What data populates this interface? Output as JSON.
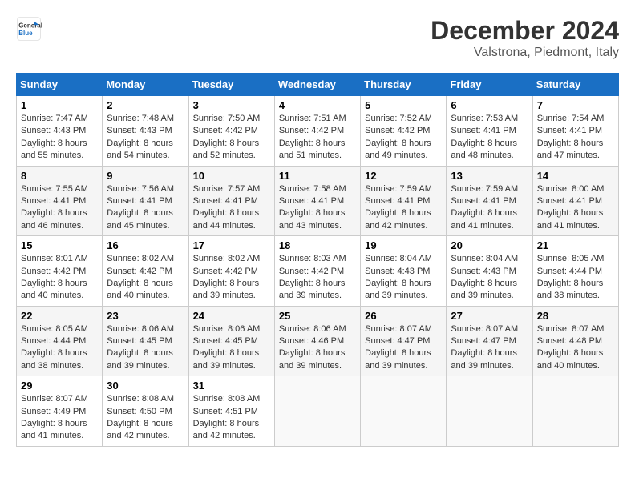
{
  "logo": {
    "line1": "General",
    "line2": "Blue"
  },
  "title": "December 2024",
  "subtitle": "Valstrona, Piedmont, Italy",
  "weekdays": [
    "Sunday",
    "Monday",
    "Tuesday",
    "Wednesday",
    "Thursday",
    "Friday",
    "Saturday"
  ],
  "weeks": [
    [
      {
        "day": "1",
        "sunrise": "7:47 AM",
        "sunset": "4:43 PM",
        "daylight": "8 hours and 55 minutes."
      },
      {
        "day": "2",
        "sunrise": "7:48 AM",
        "sunset": "4:43 PM",
        "daylight": "8 hours and 54 minutes."
      },
      {
        "day": "3",
        "sunrise": "7:50 AM",
        "sunset": "4:42 PM",
        "daylight": "8 hours and 52 minutes."
      },
      {
        "day": "4",
        "sunrise": "7:51 AM",
        "sunset": "4:42 PM",
        "daylight": "8 hours and 51 minutes."
      },
      {
        "day": "5",
        "sunrise": "7:52 AM",
        "sunset": "4:42 PM",
        "daylight": "8 hours and 49 minutes."
      },
      {
        "day": "6",
        "sunrise": "7:53 AM",
        "sunset": "4:41 PM",
        "daylight": "8 hours and 48 minutes."
      },
      {
        "day": "7",
        "sunrise": "7:54 AM",
        "sunset": "4:41 PM",
        "daylight": "8 hours and 47 minutes."
      }
    ],
    [
      {
        "day": "8",
        "sunrise": "7:55 AM",
        "sunset": "4:41 PM",
        "daylight": "8 hours and 46 minutes."
      },
      {
        "day": "9",
        "sunrise": "7:56 AM",
        "sunset": "4:41 PM",
        "daylight": "8 hours and 45 minutes."
      },
      {
        "day": "10",
        "sunrise": "7:57 AM",
        "sunset": "4:41 PM",
        "daylight": "8 hours and 44 minutes."
      },
      {
        "day": "11",
        "sunrise": "7:58 AM",
        "sunset": "4:41 PM",
        "daylight": "8 hours and 43 minutes."
      },
      {
        "day": "12",
        "sunrise": "7:59 AM",
        "sunset": "4:41 PM",
        "daylight": "8 hours and 42 minutes."
      },
      {
        "day": "13",
        "sunrise": "7:59 AM",
        "sunset": "4:41 PM",
        "daylight": "8 hours and 41 minutes."
      },
      {
        "day": "14",
        "sunrise": "8:00 AM",
        "sunset": "4:41 PM",
        "daylight": "8 hours and 41 minutes."
      }
    ],
    [
      {
        "day": "15",
        "sunrise": "8:01 AM",
        "sunset": "4:42 PM",
        "daylight": "8 hours and 40 minutes."
      },
      {
        "day": "16",
        "sunrise": "8:02 AM",
        "sunset": "4:42 PM",
        "daylight": "8 hours and 40 minutes."
      },
      {
        "day": "17",
        "sunrise": "8:02 AM",
        "sunset": "4:42 PM",
        "daylight": "8 hours and 39 minutes."
      },
      {
        "day": "18",
        "sunrise": "8:03 AM",
        "sunset": "4:42 PM",
        "daylight": "8 hours and 39 minutes."
      },
      {
        "day": "19",
        "sunrise": "8:04 AM",
        "sunset": "4:43 PM",
        "daylight": "8 hours and 39 minutes."
      },
      {
        "day": "20",
        "sunrise": "8:04 AM",
        "sunset": "4:43 PM",
        "daylight": "8 hours and 39 minutes."
      },
      {
        "day": "21",
        "sunrise": "8:05 AM",
        "sunset": "4:44 PM",
        "daylight": "8 hours and 38 minutes."
      }
    ],
    [
      {
        "day": "22",
        "sunrise": "8:05 AM",
        "sunset": "4:44 PM",
        "daylight": "8 hours and 38 minutes."
      },
      {
        "day": "23",
        "sunrise": "8:06 AM",
        "sunset": "4:45 PM",
        "daylight": "8 hours and 39 minutes."
      },
      {
        "day": "24",
        "sunrise": "8:06 AM",
        "sunset": "4:45 PM",
        "daylight": "8 hours and 39 minutes."
      },
      {
        "day": "25",
        "sunrise": "8:06 AM",
        "sunset": "4:46 PM",
        "daylight": "8 hours and 39 minutes."
      },
      {
        "day": "26",
        "sunrise": "8:07 AM",
        "sunset": "4:47 PM",
        "daylight": "8 hours and 39 minutes."
      },
      {
        "day": "27",
        "sunrise": "8:07 AM",
        "sunset": "4:47 PM",
        "daylight": "8 hours and 39 minutes."
      },
      {
        "day": "28",
        "sunrise": "8:07 AM",
        "sunset": "4:48 PM",
        "daylight": "8 hours and 40 minutes."
      }
    ],
    [
      {
        "day": "29",
        "sunrise": "8:07 AM",
        "sunset": "4:49 PM",
        "daylight": "8 hours and 41 minutes."
      },
      {
        "day": "30",
        "sunrise": "8:08 AM",
        "sunset": "4:50 PM",
        "daylight": "8 hours and 42 minutes."
      },
      {
        "day": "31",
        "sunrise": "8:08 AM",
        "sunset": "4:51 PM",
        "daylight": "8 hours and 42 minutes."
      },
      null,
      null,
      null,
      null
    ]
  ]
}
